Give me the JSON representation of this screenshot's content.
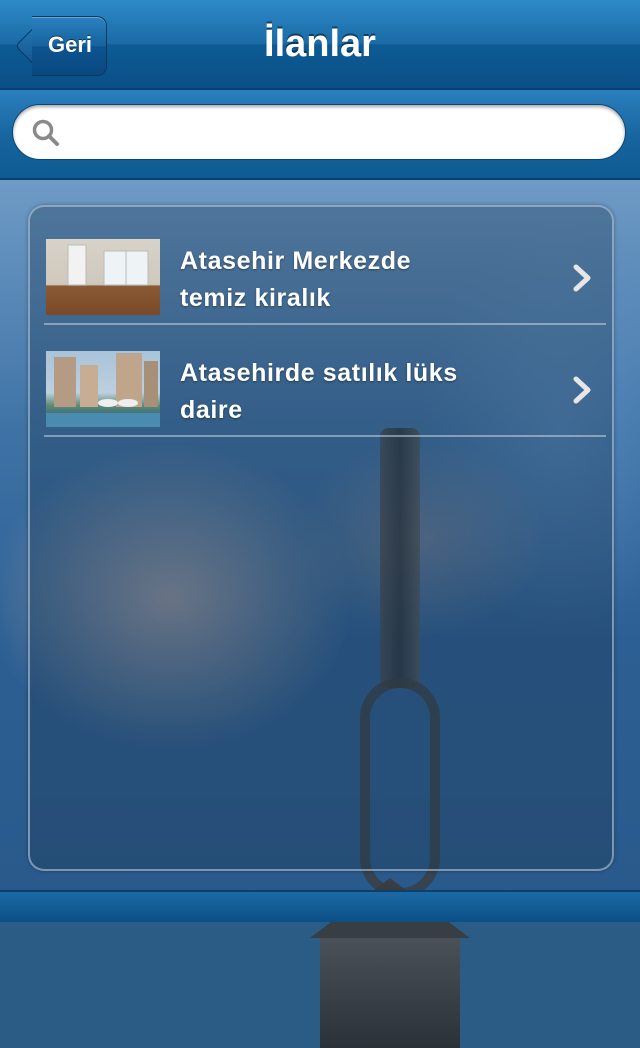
{
  "nav": {
    "back_label": "Geri",
    "title": "İlanlar"
  },
  "search": {
    "value": "",
    "placeholder": ""
  },
  "listings": [
    {
      "title_line1": "Atasehir Merkezde",
      "title_line2": "temiz kiralık"
    },
    {
      "title_line1": "Atasehirde satılık lüks",
      "title_line2": "daire"
    }
  ],
  "colors": {
    "nav_bar": "#1a6aa5",
    "text": "#ffffff"
  },
  "icons": {
    "search": "search-icon",
    "row_chevron": "chevron-right-icon",
    "back": "back-arrow-button"
  }
}
